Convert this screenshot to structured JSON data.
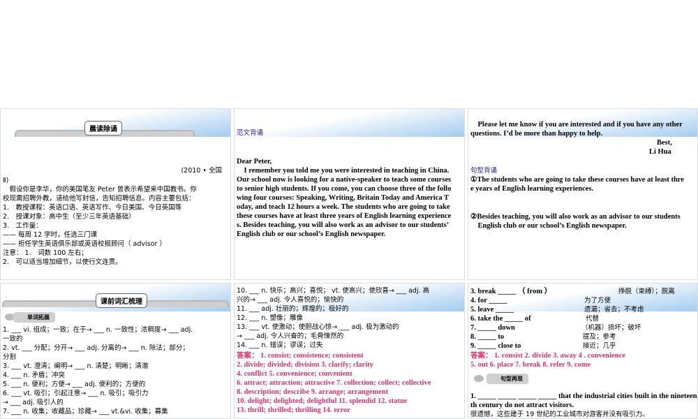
{
  "slide1": {
    "banner": "晨读除诵",
    "source": "(2010 • 全国",
    "lines": [
      "Ⅱ)",
      "　假设你是李华，你的美国笔友 Peter 曾表示希望来中国教书。你",
      "校现需招聘外教，请给他写封信，告知招聘信息。内容主要包括：",
      "1.　教授课程：英语口语、英语写作、今日美国、今日英国等",
      "2.　授课对象：高中生（至少三年英语基础）",
      "3.　工作量：",
      "—— 每周 12 学时，任选三门课",
      "—— 担任学生英语俱乐部或英语校报顾问（ advisor ）",
      "注意： 1.　词数 100 左右；",
      "2.　可以适当增加细节，以使行文连贯。"
    ]
  },
  "slide2": {
    "heading": "范文背诵",
    "lines": [
      "Dear Peter,",
      "　I remember you told me you were interested in teaching in China.",
      "Our school now is looking for a native-speaker to teach some courses",
      "to senior high students. If you come, you can choose three of the follo",
      "wing four courses: Speaking, Writing, Britain Today and America T",
      "oday, and teach 12 hours a week. The students who are going to take",
      "these courses have at least three years of English learning experience",
      "s. Besides teaching, you will also work as an advisor to our students’",
      "English club or our school’s English newspaper."
    ]
  },
  "slide3": {
    "lines": [
      "　Please let me know if you are interested and if you have any other",
      "questions. I’d be more than happy to help."
    ],
    "closing": "Best,",
    "signature": "Li Hua",
    "heading": "句型背诵",
    "s1": [
      "①The students who are going to take these courses have at least thre",
      "e years of English learning experiences."
    ],
    "s2": [
      "②Besides teaching, you will also work as an advisor to our students",
      "　English club or our school’s English newspaper."
    ]
  },
  "slide4": {
    "banner": "课前词汇梳理",
    "tag": "单词拓展",
    "lines": [
      "1. ___ vi. 组成；一致；在于→ ___ n. 一致性；浓稠度→ ___ adj.",
      "一致的",
      "2. vt. ___ 分配；分开→ ___ adj. 分离的→ ___ n. 除法；部分；",
      "分割",
      "3. ___ vt. 澄清；阐明→ ___ n. 清楚；明晰；清澈",
      "4. ___ n. 矛盾；冲突",
      "5. ___ n. 便利；方便→ ___ adj. 便利的；方便的",
      "6. ___ vt. 吸引；引起注意→ ___ n. 吸引；吸引力",
      "→ ___ adj. 吸引人的",
      "7. ___ n. 收集；收藏品；珍藏→ ___ vt.&vi. 收集；募集"
    ]
  },
  "slide5": {
    "lines": [
      "10. ___ n. 快乐；高兴；喜悦； vt. 使高兴；使欣喜→ ___ adj. 高",
      "兴的→ ___ adj. 令人喜悦的；愉快的",
      "11. ___ adj. 壮丽的；辉煌的；极好的",
      "12. ___ n. 塑像；雕像",
      "13. ___ vt. 使激动；使胆战心惊→ ___ adj. 极为激动的",
      "→ ___ adj. 令人兴奋的；毛骨悚然的",
      "14. ___ n. 错误；谬误；过失"
    ],
    "answers": [
      "答案： 1. consist; consistence; consistent",
      "2. divide; divided; division  3. clarify; clarity",
      "4. conflict   5. convenience; convenient",
      "6. attract; attraction; attractive   7. collection; collect; collective",
      "8. description; describe  9. arrange; arrangement",
      "10. delight; delighted; delightful  11. splendid   12. statue",
      "13. thrill; thrilled; thrilling   14. error"
    ]
  },
  "slide6": {
    "phrases": [
      [
        "3. break _____  （ from ）",
        "挣脱（束缚）；脱离"
      ],
      [
        "4. for _____",
        "为了方便"
      ],
      [
        "5. leave _____",
        "遗漏；省去；不考虑"
      ],
      [
        "6. take the _____ of",
        "代替"
      ],
      [
        "7. _____ down",
        "（机器）损坏；破坏"
      ],
      [
        "8. _____ to",
        "提及；参考"
      ],
      [
        "9. _____ close to",
        "接近；几乎"
      ]
    ],
    "answers": [
      "答案： 1. consist   2. divide    3. away 4 . convenience",
      "5. out    6. place    7. break    8. refer    9. come"
    ],
    "tag": "句型再现",
    "sentence": [
      "1. _____ _____ _____ _____ that the industrial cities built in the nineteen",
      "th century do not attract visitors."
    ],
    "translation": "很遗憾，这些建于 19 世纪的工业城市对游客并没有吸引力。"
  }
}
